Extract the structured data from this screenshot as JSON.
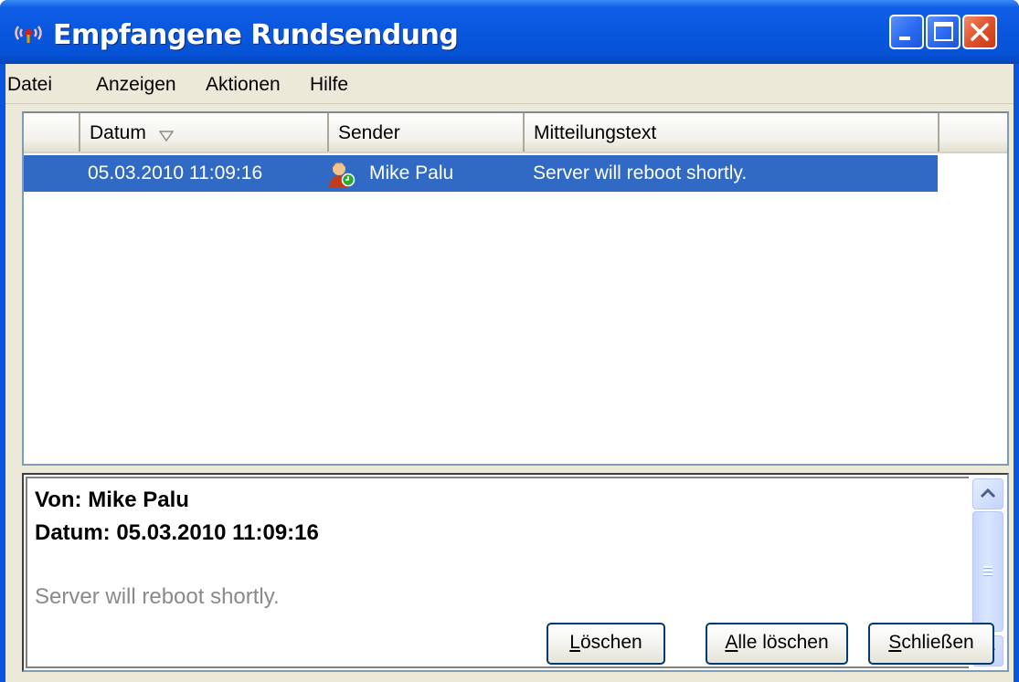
{
  "window": {
    "title": "Empfangene Rundsendung"
  },
  "menu": {
    "items": [
      "Datei",
      "Anzeigen",
      "Aktionen",
      "Hilfe"
    ]
  },
  "list": {
    "columns": [
      {
        "label": "Datum",
        "sorted": "descending"
      },
      {
        "label": "Sender"
      },
      {
        "label": "Mitteilungstext"
      }
    ],
    "rows": [
      {
        "datum": "05.03.2010 11:09:16",
        "sender": "Mike Palu",
        "text": "Server will reboot shortly.",
        "selected": true
      }
    ]
  },
  "preview": {
    "from": "Von: Mike Palu",
    "date": "Datum: 05.03.2010 11:09:16",
    "body": "Server will reboot shortly."
  },
  "buttons": {
    "delete": {
      "mnemonic": "L",
      "rest": "öschen"
    },
    "delete_all": {
      "mnemonic": "A",
      "rest": "lle löschen"
    },
    "close": {
      "mnemonic": "S",
      "rest": "chließen"
    }
  },
  "colors": {
    "titlebar": "#0a57df",
    "selection": "#316ac5",
    "client": "#ece9d8"
  }
}
